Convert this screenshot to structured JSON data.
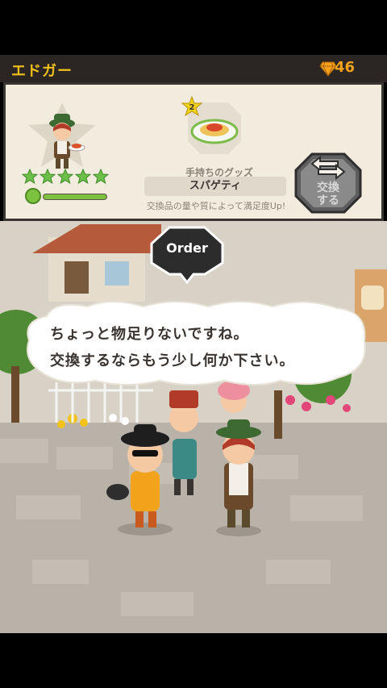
{
  "header": {
    "character_name": "エドガー",
    "gem_icon": "gem-icon",
    "gem_count": "46"
  },
  "panel": {
    "rarity_level": "2",
    "star_rating": 5,
    "mood_level": 1.0,
    "goods_label": "手持ちのグッズ",
    "goods_name": "スパゲティ",
    "goods_note": "交換品の量や質によって満足度Up!",
    "exchange_button": "交換\nする"
  },
  "scene": {
    "order_label": "Order",
    "speech_line1": "ちょっと物足りないですね。",
    "speech_line2": "交換するならもう少し何か下さい。"
  },
  "colors": {
    "header_bg": "#2b2623",
    "name_color": "#f3c21a",
    "gem_color": "#f5a21b",
    "panel_bg": "#f1ecde",
    "star_green": "#6cc04a"
  }
}
